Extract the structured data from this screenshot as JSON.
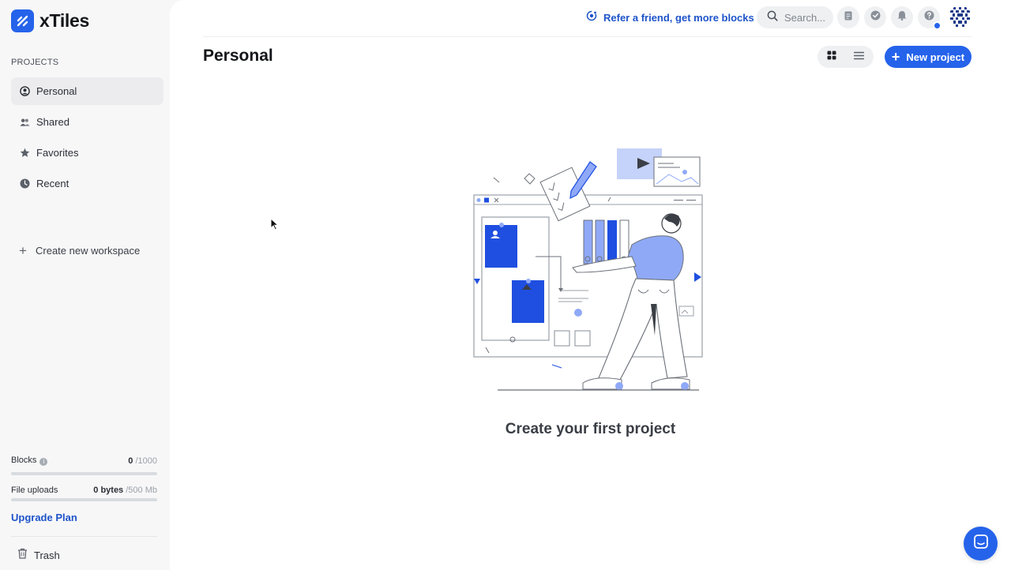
{
  "app": {
    "name": "xTiles"
  },
  "sidebar": {
    "section_label": "PROJECTS",
    "items": [
      {
        "label": "Personal",
        "icon": "user-circle-icon",
        "active": true
      },
      {
        "label": "Shared",
        "icon": "users-icon",
        "active": false
      },
      {
        "label": "Favorites",
        "icon": "star-icon",
        "active": false
      },
      {
        "label": "Recent",
        "icon": "clock-icon",
        "active": false
      }
    ],
    "create_workspace_label": "Create new workspace",
    "usage": {
      "blocks": {
        "label": "Blocks",
        "used": "0",
        "max": "/1000",
        "fraction": 0
      },
      "uploads": {
        "label": "File uploads",
        "used": "0 bytes",
        "max": "/500 Mb",
        "fraction": 0
      }
    },
    "upgrade_label": "Upgrade Plan",
    "trash_label": "Trash"
  },
  "topbar": {
    "refer_label": "Refer a friend, get more blocks",
    "search_placeholder": "Search..."
  },
  "main": {
    "title": "Personal",
    "new_project_label": "New project",
    "empty_state_title": "Create your first project"
  },
  "colors": {
    "accent": "#2563eb",
    "link": "#1e54c9",
    "illustration_blue": "#1f4fe0",
    "illustration_light": "#8fa9f7"
  }
}
